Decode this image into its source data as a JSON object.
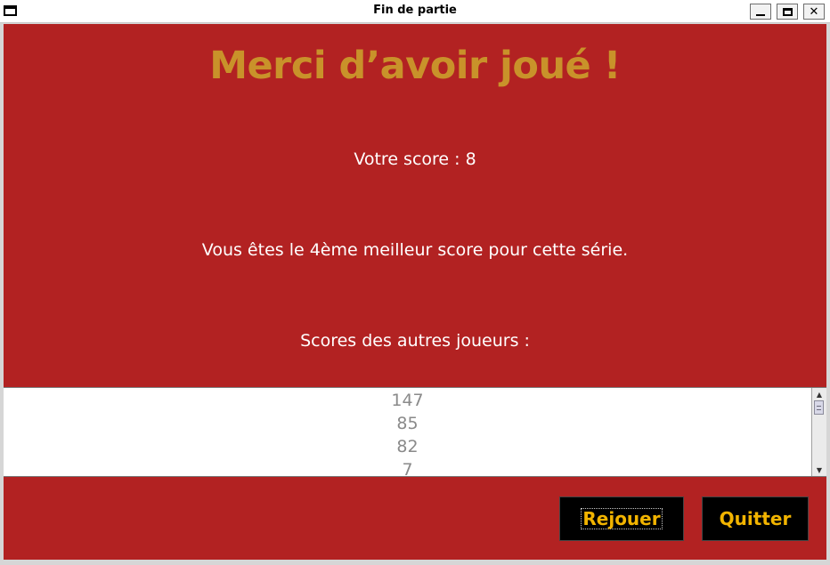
{
  "window": {
    "title": "Fin de partie"
  },
  "main": {
    "heading": "Merci d’avoir joué !",
    "score_text": "Votre score : 8",
    "rank_text": "Vous êtes le 4ème meilleur score pour cette série.",
    "others_label": "Scores des autres joueurs :",
    "other_scores": [
      "147",
      "85",
      "82",
      "7"
    ]
  },
  "buttons": {
    "replay_label": "Rejouer",
    "quit_label": "Quitter"
  },
  "colors": {
    "background": "#b22222",
    "heading": "#c9922a",
    "button_bg": "#000000",
    "button_text": "#f2b400"
  },
  "icons": {
    "window_menu": "window-menu-icon",
    "minimize": "minimize-icon",
    "maximize": "maximize-icon",
    "close": "close-icon",
    "scroll_up": "arrow-up-icon",
    "scroll_down": "arrow-down-icon"
  }
}
